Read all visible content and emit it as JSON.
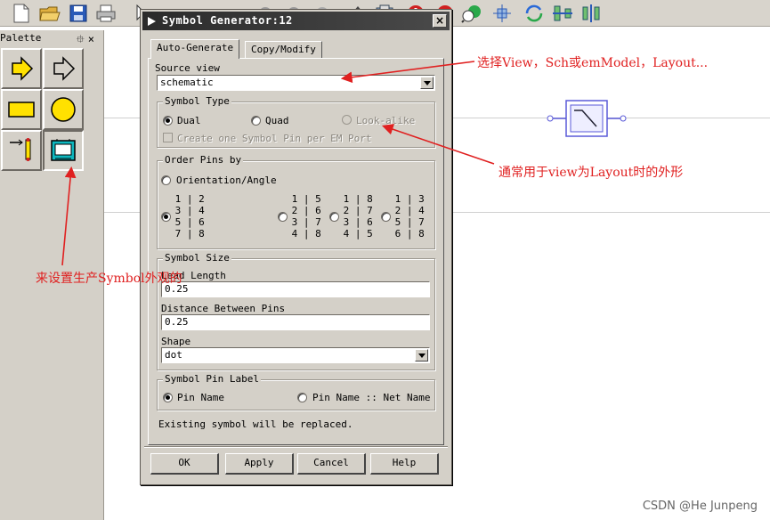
{
  "palette": {
    "title": "Palette",
    "controls": "⯐×"
  },
  "dialog": {
    "title": "Symbol Generator:12",
    "close_symbol": "×",
    "tabs": [
      {
        "label": "Auto-Generate"
      },
      {
        "label": "Copy/Modify"
      }
    ],
    "source_view": {
      "label": "Source view",
      "value": "schematic"
    },
    "symbol_type": {
      "title": "Symbol Type",
      "options": [
        {
          "label": "Dual",
          "selected": true
        },
        {
          "label": "Quad",
          "selected": false
        },
        {
          "label": "Look-alike",
          "selected": false
        }
      ],
      "checkbox_label": "Create one Symbol Pin per EM Port"
    },
    "order_pins": {
      "title": "Order Pins by",
      "orientation_label": "Orientation/Angle",
      "patterns": [
        " 1 | 2\n 3 | 4\n 5 | 6\n 7 | 8",
        " 1 | 5\n 2 | 6\n 3 | 7\n 4 | 8",
        " 1 | 8\n 2 | 7\n 3 | 6\n 4 | 5",
        " 1 | 3\n 2 | 4\n 5 | 7\n 6 | 8"
      ]
    },
    "symbol_size": {
      "title": "Symbol Size",
      "lead_length_label": "Lead Length",
      "lead_length_value": "0.25",
      "distance_label": "Distance Between Pins",
      "distance_value": "0.25",
      "shape_label": "Shape",
      "shape_value": "dot"
    },
    "pin_label": {
      "title": "Symbol Pin Label",
      "options": [
        {
          "label": "Pin Name",
          "selected": true
        },
        {
          "label": "Pin Name :: Net Name",
          "selected": false
        }
      ]
    },
    "status_text": "Existing symbol will be replaced.",
    "buttons": {
      "ok": "OK",
      "apply": "Apply",
      "cancel": "Cancel",
      "help": "Help"
    }
  },
  "annotations": {
    "view_note": "选择View，Sch或emModel，Layout...",
    "lookalike_note": "通常用于view为Layout时的外形",
    "palette_note": "来设置生产Symbol外观的"
  },
  "watermark": "CSDN @He Junpeng",
  "colors": {
    "annotation": "#e02020",
    "symbol_blue": "#5a5ad8",
    "titlebar": "#2b2b2b"
  }
}
